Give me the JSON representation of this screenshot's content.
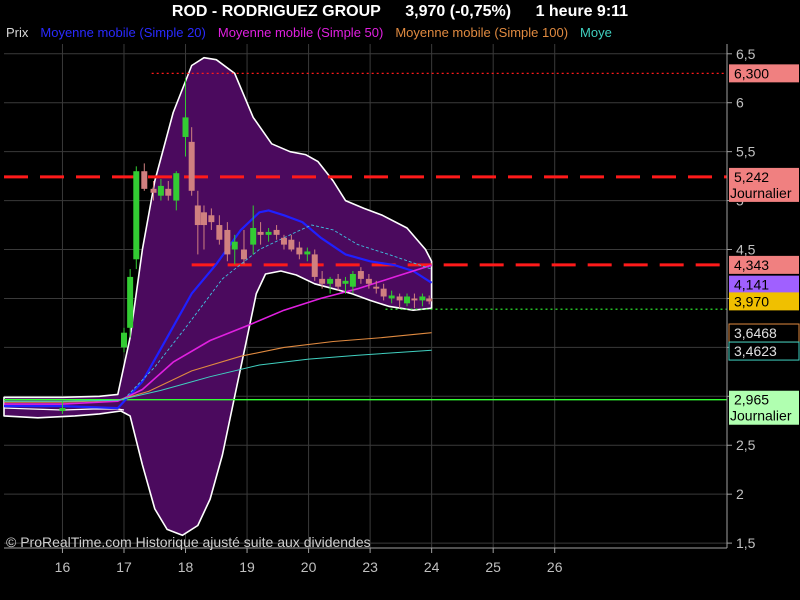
{
  "header": {
    "symbol": "ROD - RODRIGUEZ GROUP",
    "price_change": "3,970 (-0,75%)",
    "timeframe_time": "1 heure  9:11"
  },
  "legend": [
    {
      "label": "Prix",
      "color": "#d8d8d8"
    },
    {
      "label": "Moyenne mobile (Simple 20)",
      "color": "#2a2aff"
    },
    {
      "label": "Moyenne mobile (Simple 50)",
      "color": "#e020e0"
    },
    {
      "label": "Moyenne mobile (Simple 100)",
      "color": "#e08a40"
    },
    {
      "label": "Moye",
      "color": "#40d0c0"
    }
  ],
  "watermark": "© ProRealTime.com Historique ajusté suite aux dividendes",
  "colors": {
    "background": "#000000",
    "band_fill": "#4b0a5e",
    "band_outline": "#ffffff",
    "candle_up": "#33cc33",
    "candle_down": "#d08080",
    "resistance": "#ff1a1a",
    "support": "#33ff33",
    "grid": "#3a3a3a",
    "axis_text": "#c0c0c0"
  },
  "chart_data": {
    "type": "line",
    "y_axis": {
      "min": 1.45,
      "max": 6.6,
      "ticks": [
        "1,5",
        "2",
        "2,5",
        "3",
        "3,5",
        "4",
        "4,5",
        "5",
        "5,5",
        "6",
        "6,5"
      ],
      "tick_values": [
        1.5,
        2,
        2.5,
        3,
        3.5,
        4,
        4.5,
        5,
        5.5,
        6,
        6.5
      ]
    },
    "x_axis": {
      "min": 15.05,
      "max": 26.8,
      "ticks": [
        "16",
        "17",
        "18",
        "19",
        "20",
        "23",
        "24",
        "25",
        "26"
      ],
      "tick_positions": [
        16,
        17,
        18,
        19,
        20,
        21,
        22,
        23,
        24
      ]
    },
    "grid": true,
    "price_labels": [
      {
        "text": "6,300",
        "value": 6.3,
        "bg": "#f08080",
        "fg": "#000000"
      },
      {
        "text": "5,242",
        "value": 5.242,
        "sub": "Journalier",
        "bg": "#f08080",
        "fg": "#000000"
      },
      {
        "text": "4,343",
        "value": 4.343,
        "bg": "#f08080",
        "fg": "#000000"
      },
      {
        "text": "4,141",
        "value": 4.141,
        "bg": "#a060ff",
        "fg": "#000000"
      },
      {
        "text": "3,970",
        "value": 3.97,
        "bg": "#f0c000",
        "fg": "#000000"
      },
      {
        "text": "3,6468",
        "value": 3.6468,
        "bg": "#000000",
        "fg": "#e0e0e0",
        "border": "#e08a40"
      },
      {
        "text": "3,4623",
        "value": 3.4623,
        "bg": "#000000",
        "fg": "#e0e0e0",
        "border": "#40d0c0"
      },
      {
        "text": "2,965",
        "value": 2.965,
        "sub": "Journalier",
        "bg": "#b0ffb0",
        "fg": "#000000"
      }
    ],
    "levels": [
      {
        "name": "resistance-daily",
        "value": 5.242,
        "x_start": 15.05,
        "style": "dashed",
        "color": "#ff1a1a"
      },
      {
        "name": "resistance-intraday",
        "value": 4.343,
        "x_start": 18.1,
        "style": "dashed",
        "color": "#ff1a1a"
      },
      {
        "name": "high-level",
        "value": 6.3,
        "x_start": 17.45,
        "style": "dotted",
        "color": "#ff1a1a"
      },
      {
        "name": "support-daily",
        "value": 2.965,
        "x_start": 15.05,
        "style": "solid",
        "color": "#33ff33"
      },
      {
        "name": "last-price",
        "value": 3.89,
        "x_start": 21.25,
        "style": "dotted",
        "color": "#33ff33"
      }
    ],
    "bollinger_upper": [
      [
        15.05,
        2.99
      ],
      [
        16,
        2.99
      ],
      [
        16.6,
        3.0
      ],
      [
        16.9,
        3.02
      ],
      [
        17.1,
        3.6
      ],
      [
        17.3,
        4.5
      ],
      [
        17.5,
        5.2
      ],
      [
        17.8,
        5.9
      ],
      [
        18.1,
        6.38
      ],
      [
        18.3,
        6.46
      ],
      [
        18.5,
        6.44
      ],
      [
        18.8,
        6.3
      ],
      [
        19.1,
        5.85
      ],
      [
        19.4,
        5.58
      ],
      [
        19.7,
        5.5
      ],
      [
        19.95,
        5.47
      ],
      [
        20.15,
        5.4
      ],
      [
        20.4,
        5.2
      ],
      [
        20.6,
        5.0
      ],
      [
        20.9,
        4.92
      ],
      [
        21.2,
        4.85
      ],
      [
        21.6,
        4.72
      ],
      [
        21.9,
        4.5
      ],
      [
        22.0,
        4.38
      ]
    ],
    "bollinger_lower": [
      [
        22.0,
        3.9
      ],
      [
        21.7,
        3.88
      ],
      [
        21.3,
        3.92
      ],
      [
        21.0,
        3.98
      ],
      [
        20.7,
        4.05
      ],
      [
        20.4,
        4.1
      ],
      [
        20.1,
        4.15
      ],
      [
        19.8,
        4.24
      ],
      [
        19.55,
        4.28
      ],
      [
        19.3,
        4.25
      ],
      [
        19.15,
        4.05
      ],
      [
        19.0,
        3.6
      ],
      [
        18.8,
        3.0
      ],
      [
        18.6,
        2.4
      ],
      [
        18.4,
        1.95
      ],
      [
        18.2,
        1.68
      ],
      [
        17.95,
        1.58
      ],
      [
        17.7,
        1.64
      ],
      [
        17.5,
        1.85
      ],
      [
        17.3,
        2.3
      ],
      [
        17.1,
        2.8
      ],
      [
        16.95,
        2.85
      ],
      [
        16.6,
        2.82
      ],
      [
        16.2,
        2.8
      ],
      [
        15.6,
        2.78
      ],
      [
        15.05,
        2.8
      ]
    ],
    "series": [
      {
        "name": "Moyenne mobile (Simple 20)",
        "color": "#2020ff",
        "width": 2.2,
        "points": [
          [
            15.05,
            2.9
          ],
          [
            16,
            2.9
          ],
          [
            16.9,
            2.88
          ],
          [
            17.3,
            3.15
          ],
          [
            17.7,
            3.6
          ],
          [
            18.1,
            4.05
          ],
          [
            18.5,
            4.35
          ],
          [
            18.9,
            4.7
          ],
          [
            19.2,
            4.88
          ],
          [
            19.35,
            4.9
          ],
          [
            19.6,
            4.85
          ],
          [
            19.9,
            4.78
          ],
          [
            20.2,
            4.62
          ],
          [
            20.6,
            4.45
          ],
          [
            21.0,
            4.38
          ],
          [
            21.4,
            4.34
          ],
          [
            21.7,
            4.28
          ],
          [
            22.0,
            4.16
          ]
        ]
      },
      {
        "name": "Moyenne mobile (Simple 50)",
        "color": "#e020e0",
        "width": 1.6,
        "points": [
          [
            15.05,
            2.92
          ],
          [
            16,
            2.92
          ],
          [
            16.9,
            2.95
          ],
          [
            17.3,
            3.07
          ],
          [
            17.8,
            3.35
          ],
          [
            18.4,
            3.57
          ],
          [
            19.0,
            3.72
          ],
          [
            19.6,
            3.88
          ],
          [
            20.2,
            4.0
          ],
          [
            20.8,
            4.1
          ],
          [
            21.4,
            4.22
          ],
          [
            22.0,
            4.34
          ]
        ]
      },
      {
        "name": "Moyenne mobile (Simple 100)",
        "color": "#e08a40",
        "width": 1.1,
        "points": [
          [
            15.05,
            2.94
          ],
          [
            16,
            2.94
          ],
          [
            16.9,
            2.96
          ],
          [
            17.4,
            3.05
          ],
          [
            18.1,
            3.26
          ],
          [
            18.9,
            3.41
          ],
          [
            19.6,
            3.5
          ],
          [
            20.4,
            3.56
          ],
          [
            21.2,
            3.6
          ],
          [
            22.0,
            3.65
          ]
        ]
      },
      {
        "name": "Moye",
        "color": "#40d0c0",
        "width": 1.0,
        "points": [
          [
            15.05,
            2.95
          ],
          [
            16,
            2.95
          ],
          [
            16.9,
            2.96
          ],
          [
            17.6,
            3.06
          ],
          [
            18.4,
            3.2
          ],
          [
            19.2,
            3.32
          ],
          [
            20.0,
            3.38
          ],
          [
            20.8,
            3.42
          ],
          [
            22.0,
            3.47
          ]
        ]
      },
      {
        "name": "dashed-mid-band",
        "color": "#40c0e0",
        "width": 0.9,
        "dash": "3,2",
        "points": [
          [
            17.0,
            2.97
          ],
          [
            17.5,
            3.3
          ],
          [
            18.0,
            3.7
          ],
          [
            18.6,
            4.2
          ],
          [
            19.2,
            4.5
          ],
          [
            19.8,
            4.68
          ],
          [
            20.05,
            4.75
          ],
          [
            20.4,
            4.7
          ],
          [
            20.8,
            4.55
          ],
          [
            21.3,
            4.45
          ],
          [
            22.0,
            4.3
          ]
        ]
      }
    ],
    "price_line_left": [
      [
        15.05,
        2.88
      ],
      [
        15.5,
        2.87
      ],
      [
        16.0,
        2.86
      ],
      [
        16.5,
        2.87
      ],
      [
        16.9,
        2.87
      ],
      [
        17.0,
        2.86
      ]
    ],
    "candles": [
      {
        "x": 16.0,
        "o": 2.85,
        "h": 2.95,
        "l": 2.82,
        "c": 2.88
      },
      {
        "x": 17.0,
        "o": 3.5,
        "h": 3.7,
        "l": 3.45,
        "c": 3.65
      },
      {
        "x": 17.1,
        "o": 3.7,
        "h": 4.3,
        "l": 3.6,
        "c": 4.22
      },
      {
        "x": 17.2,
        "o": 4.4,
        "h": 5.35,
        "l": 4.3,
        "c": 5.3
      },
      {
        "x": 17.33,
        "o": 5.3,
        "h": 5.38,
        "l": 5.1,
        "c": 5.12
      },
      {
        "x": 17.48,
        "o": 5.12,
        "h": 5.2,
        "l": 5.0,
        "c": 5.08
      },
      {
        "x": 17.6,
        "o": 5.05,
        "h": 5.22,
        "l": 5.0,
        "c": 5.15
      },
      {
        "x": 17.72,
        "o": 5.12,
        "h": 5.2,
        "l": 5.0,
        "c": 5.05
      },
      {
        "x": 17.85,
        "o": 5.0,
        "h": 5.3,
        "l": 4.9,
        "c": 5.28
      },
      {
        "x": 18.0,
        "o": 5.65,
        "h": 6.25,
        "l": 5.45,
        "c": 5.85
      },
      {
        "x": 18.1,
        "o": 5.6,
        "h": 5.75,
        "l": 5.05,
        "c": 5.1
      },
      {
        "x": 18.2,
        "o": 4.95,
        "h": 5.1,
        "l": 4.45,
        "c": 4.75
      },
      {
        "x": 18.3,
        "o": 4.88,
        "h": 4.95,
        "l": 4.5,
        "c": 4.75
      },
      {
        "x": 18.42,
        "o": 4.85,
        "h": 4.92,
        "l": 4.7,
        "c": 4.78
      },
      {
        "x": 18.55,
        "o": 4.75,
        "h": 4.85,
        "l": 4.55,
        "c": 4.6
      },
      {
        "x": 18.68,
        "o": 4.7,
        "h": 4.78,
        "l": 4.38,
        "c": 4.45
      },
      {
        "x": 18.8,
        "o": 4.5,
        "h": 4.65,
        "l": 4.35,
        "c": 4.58
      },
      {
        "x": 18.95,
        "o": 4.5,
        "h": 4.7,
        "l": 4.35,
        "c": 4.4
      },
      {
        "x": 19.1,
        "o": 4.55,
        "h": 4.95,
        "l": 4.45,
        "c": 4.72
      },
      {
        "x": 19.22,
        "o": 4.68,
        "h": 4.78,
        "l": 4.55,
        "c": 4.65
      },
      {
        "x": 19.35,
        "o": 4.65,
        "h": 4.72,
        "l": 4.58,
        "c": 4.68
      },
      {
        "x": 19.48,
        "o": 4.7,
        "h": 4.75,
        "l": 4.6,
        "c": 4.65
      },
      {
        "x": 19.6,
        "o": 4.62,
        "h": 4.65,
        "l": 4.5,
        "c": 4.55
      },
      {
        "x": 19.72,
        "o": 4.6,
        "h": 4.65,
        "l": 4.48,
        "c": 4.5
      },
      {
        "x": 19.85,
        "o": 4.52,
        "h": 4.58,
        "l": 4.4,
        "c": 4.45
      },
      {
        "x": 19.98,
        "o": 4.45,
        "h": 4.52,
        "l": 4.38,
        "c": 4.48
      },
      {
        "x": 20.1,
        "o": 4.45,
        "h": 4.5,
        "l": 4.18,
        "c": 4.22
      },
      {
        "x": 20.22,
        "o": 4.2,
        "h": 4.28,
        "l": 4.1,
        "c": 4.15
      },
      {
        "x": 20.35,
        "o": 4.15,
        "h": 4.22,
        "l": 4.05,
        "c": 4.2
      },
      {
        "x": 20.48,
        "o": 4.2,
        "h": 4.25,
        "l": 4.08,
        "c": 4.12
      },
      {
        "x": 20.6,
        "o": 4.15,
        "h": 4.22,
        "l": 4.05,
        "c": 4.18
      },
      {
        "x": 20.72,
        "o": 4.12,
        "h": 4.28,
        "l": 4.05,
        "c": 4.25
      },
      {
        "x": 20.85,
        "o": 4.28,
        "h": 4.32,
        "l": 4.15,
        "c": 4.2
      },
      {
        "x": 20.98,
        "o": 4.2,
        "h": 4.25,
        "l": 4.1,
        "c": 4.15
      },
      {
        "x": 21.1,
        "o": 4.12,
        "h": 4.18,
        "l": 4.05,
        "c": 4.1
      },
      {
        "x": 21.22,
        "o": 4.1,
        "h": 4.15,
        "l": 3.98,
        "c": 4.02
      },
      {
        "x": 21.35,
        "o": 4.0,
        "h": 4.08,
        "l": 3.95,
        "c": 4.03
      },
      {
        "x": 21.48,
        "o": 4.02,
        "h": 4.05,
        "l": 3.9,
        "c": 3.98
      },
      {
        "x": 21.6,
        "o": 3.95,
        "h": 4.05,
        "l": 3.92,
        "c": 4.02
      },
      {
        "x": 21.72,
        "o": 4.0,
        "h": 4.05,
        "l": 3.9,
        "c": 3.98
      },
      {
        "x": 21.85,
        "o": 3.98,
        "h": 4.05,
        "l": 3.92,
        "c": 4.02
      },
      {
        "x": 21.96,
        "o": 4.0,
        "h": 4.03,
        "l": 3.94,
        "c": 3.97
      }
    ]
  }
}
